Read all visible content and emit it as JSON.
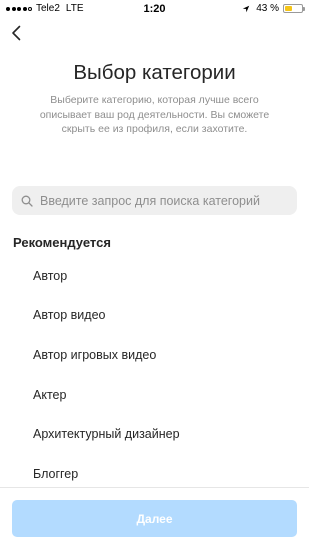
{
  "status_bar": {
    "carrier": "Tele2",
    "network": "LTE",
    "time": "1:20",
    "battery_percent": "43 %",
    "battery_level": 0.43,
    "battery_color": "#f5c518",
    "signal_bars": 4
  },
  "header": {
    "back_icon": "chevron-left-icon",
    "title": "Выбор категории",
    "description": "Выберите категорию, которая лучше всего описывает ваш род деятельности. Вы сможете скрыть ее из профиля, если захотите."
  },
  "search": {
    "icon": "search-icon",
    "placeholder": "Введите запрос для поиска категорий",
    "value": ""
  },
  "list": {
    "section_title": "Рекомендуется",
    "items": [
      {
        "label": "Автор"
      },
      {
        "label": "Автор видео"
      },
      {
        "label": "Автор игровых видео"
      },
      {
        "label": "Актер"
      },
      {
        "label": "Архитектурный дизайнер"
      },
      {
        "label": "Блоггер"
      }
    ]
  },
  "footer": {
    "next_label": "Далее",
    "next_enabled": false,
    "next_color": "#b3dbff"
  }
}
